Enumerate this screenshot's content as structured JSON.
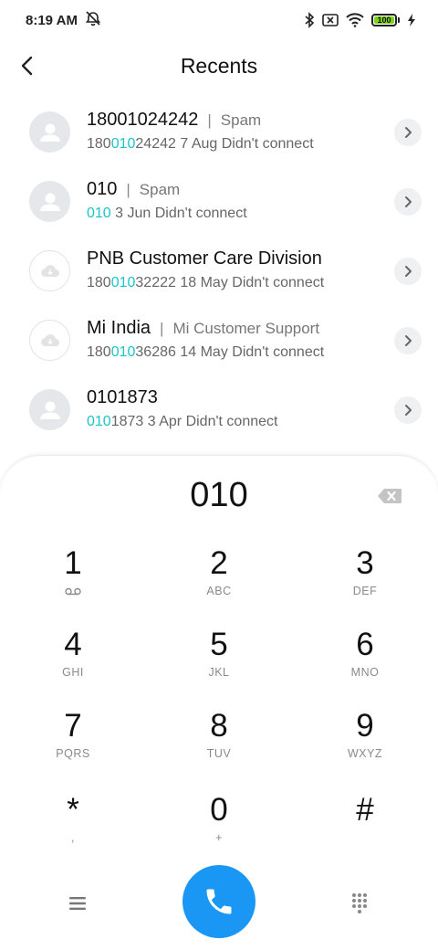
{
  "status_bar": {
    "time": "8:19 AM",
    "battery": "100",
    "icons": [
      "alarm-off-icon",
      "bluetooth-icon",
      "no-sim-icon",
      "wifi-icon",
      "battery-icon",
      "charging-icon"
    ]
  },
  "header": {
    "title": "Recents",
    "back_icon": "back-icon"
  },
  "recents": [
    {
      "name": "18001024242",
      "tag": "Spam",
      "number_pre": "180",
      "number_match": "010",
      "number_post": "24242",
      "date": "7 Aug",
      "status": "Didn't connect",
      "avatar": "person"
    },
    {
      "name": "010",
      "tag": "Spam",
      "number_pre": "",
      "number_match": "010",
      "number_post": "",
      "date": "3 Jun",
      "status": "Didn't connect",
      "avatar": "person"
    },
    {
      "name": "PNB Customer Care Division",
      "tag": "",
      "number_pre": "180",
      "number_match": "010",
      "number_post": "32222",
      "date": "18 May",
      "status": "Didn't connect",
      "avatar": "cloud"
    },
    {
      "name": "Mi India",
      "tag": "Mi Customer Support",
      "number_pre": "180",
      "number_match": "010",
      "number_post": "36286",
      "date": "14 May",
      "status": "Didn't connect",
      "avatar": "cloud"
    },
    {
      "name": "0101873",
      "tag": "",
      "number_pre": "",
      "number_match": "010",
      "number_post": "1873",
      "date": "3 Apr",
      "status": "Didn't connect",
      "avatar": "person"
    }
  ],
  "dialpad": {
    "entered": "010",
    "keys": [
      {
        "digit": "1",
        "letters": ""
      },
      {
        "digit": "2",
        "letters": "ABC"
      },
      {
        "digit": "3",
        "letters": "DEF"
      },
      {
        "digit": "4",
        "letters": "GHI"
      },
      {
        "digit": "5",
        "letters": "JKL"
      },
      {
        "digit": "6",
        "letters": "MNO"
      },
      {
        "digit": "7",
        "letters": "PQRS"
      },
      {
        "digit": "8",
        "letters": "TUV"
      },
      {
        "digit": "9",
        "letters": "WXYZ"
      },
      {
        "digit": "*",
        "letters": ","
      },
      {
        "digit": "0",
        "letters": "+"
      },
      {
        "digit": "#",
        "letters": ""
      }
    ]
  },
  "colors": {
    "accent": "#1a97f5",
    "match_highlight": "#1cc4c9",
    "battery_fill": "#7ed321"
  }
}
